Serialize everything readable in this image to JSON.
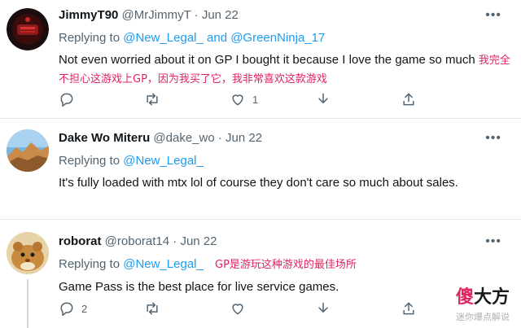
{
  "tweets": [
    {
      "name": "JimmyT90",
      "handle": "@MrJimmyT",
      "date": "· Jun 22",
      "replying_prefix": "Replying to ",
      "replying_to": "@New_Legal_ and @GreenNinja_17",
      "text": "Not even worried about it on GP I bought it because I love the game so much",
      "cn_note": "我完全不担心这游戏上GP，因为我买了它，我非常喜欢这款游戏",
      "counts": {
        "reply": "",
        "retweet": "",
        "like": "1"
      }
    },
    {
      "name": "Dake Wo Miteru",
      "handle": "@dake_wo",
      "date": "· Jun 22",
      "replying_prefix": "Replying to ",
      "replying_to": "@New_Legal_",
      "text": "It's fully loaded with mtx lol of course they don't care so much about sales.",
      "cn_note": "",
      "counts": {
        "reply": "",
        "retweet": "",
        "like": ""
      }
    },
    {
      "name": "roborat",
      "handle": "@roborat14",
      "date": "· Jun 22",
      "replying_prefix": "Replying to ",
      "replying_to": "@New_Legal_",
      "text": "Game Pass is the best place for live service games.",
      "cn_note": "GP是游玩这种游戏的最佳场所",
      "counts": {
        "reply": "2",
        "retweet": "",
        "like": ""
      }
    }
  ],
  "watermark": {
    "logo_first": "傻",
    "logo_rest": "大方",
    "subtitle": "迷你爆点解说"
  },
  "icons": {
    "more": "more-horizontal-icon",
    "reply": "reply-bubble-icon",
    "retweet": "retweet-icon",
    "like": "heart-icon",
    "download": "download-arrow-icon",
    "share": "share-upload-icon"
  },
  "colors": {
    "link": "#1d9bf0",
    "muted": "#536471",
    "annotation": "#e0245e"
  }
}
